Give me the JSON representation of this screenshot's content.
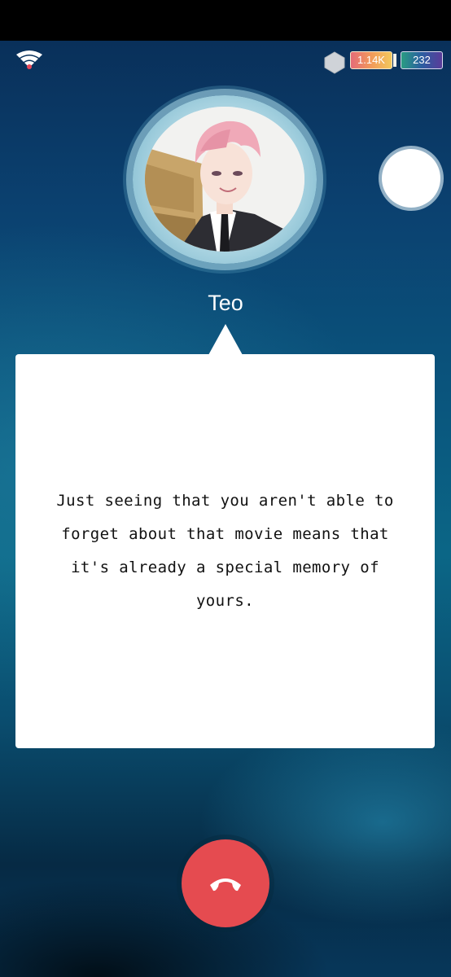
{
  "status": {
    "signal_icon": "wifi-signal-icon",
    "gem_icon": "hexagon-gem-icon",
    "hourglass_count": "1.14K",
    "battery_count": "232"
  },
  "call": {
    "caller_name": "Teo",
    "avatar_icon": "caller-avatar",
    "message": "Just seeing that you aren't able to forget about that movie means that it's already a special memory of yours.",
    "end_call_icon": "phone-hangup-icon"
  },
  "colors": {
    "end_call": "#e54b50",
    "bubble": "#ffffff",
    "background_top": "#09305a",
    "background_mid": "#0b6686"
  }
}
